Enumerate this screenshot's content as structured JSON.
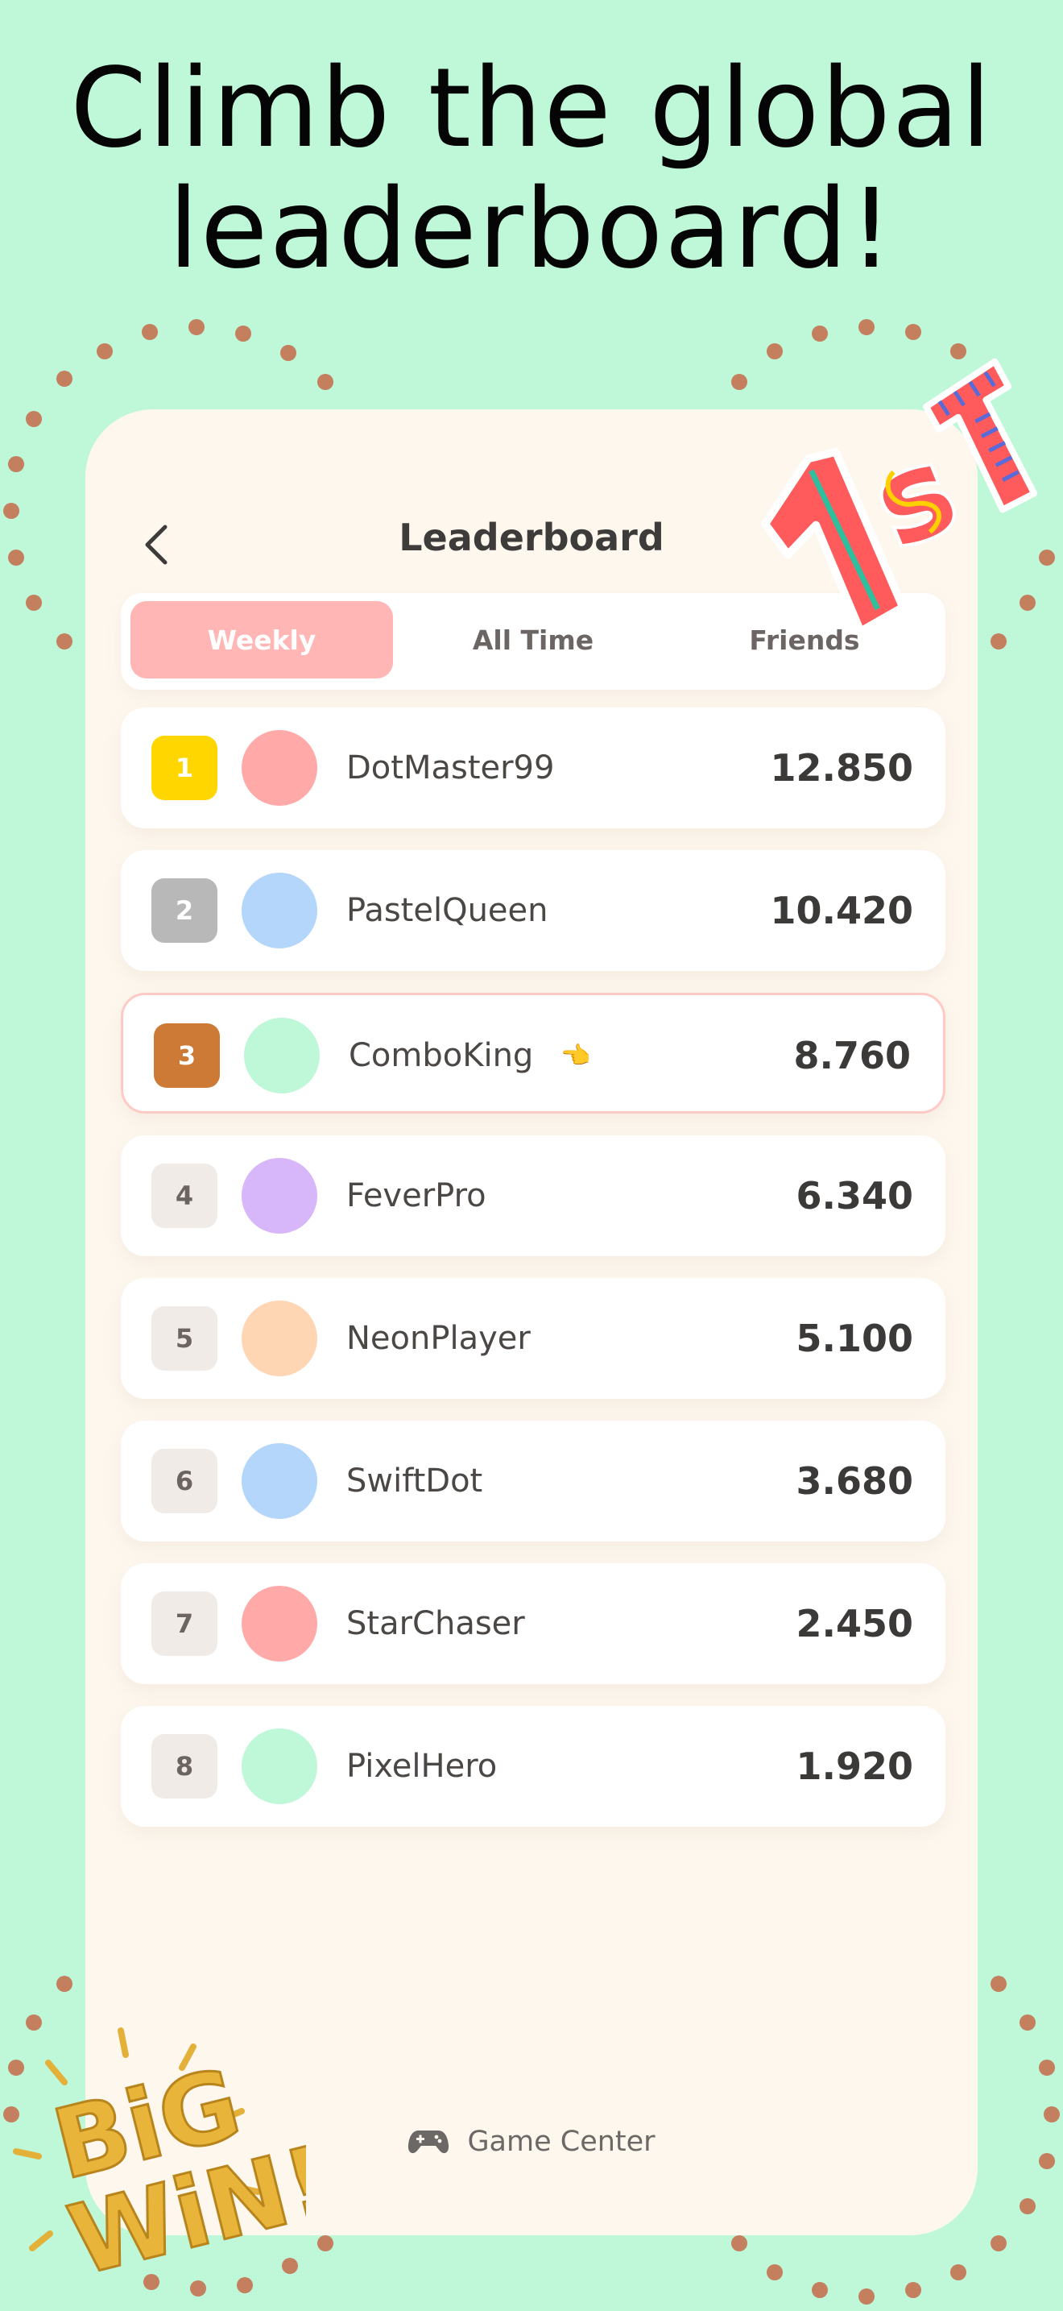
{
  "headline": {
    "line1": "Climb the global",
    "line2": "leaderboard!"
  },
  "screen": {
    "title": "Leaderboard"
  },
  "tabs": [
    {
      "label": "Weekly",
      "active": true
    },
    {
      "label": "All Time",
      "active": false
    },
    {
      "label": "Friends",
      "active": false
    }
  ],
  "rows": [
    {
      "rank": "1",
      "name": "DotMaster99",
      "score": "12.850",
      "rank_color": "#ffd600",
      "avatar_color": "#ffaaa9"
    },
    {
      "rank": "2",
      "name": "PastelQueen",
      "score": "10.420",
      "rank_color": "#b8b8b8",
      "avatar_color": "#b4d6fb"
    },
    {
      "rank": "3",
      "name": "ComboKing",
      "score": "8.760",
      "rank_color": "#cc7a36",
      "avatar_color": "#bff8d8",
      "highlight": true,
      "pointer": "👈"
    },
    {
      "rank": "4",
      "name": "FeverPro",
      "score": "6.340",
      "rank_color": "#f0ebe6",
      "avatar_color": "#d8b6fa"
    },
    {
      "rank": "5",
      "name": "NeonPlayer",
      "score": "5.100",
      "rank_color": "#f0ebe6",
      "avatar_color": "#ffd6b4"
    },
    {
      "rank": "6",
      "name": "SwiftDot",
      "score": "3.680",
      "rank_color": "#f0ebe6",
      "avatar_color": "#b4d6fb"
    },
    {
      "rank": "7",
      "name": "StarChaser",
      "score": "2.450",
      "rank_color": "#f0ebe6",
      "avatar_color": "#ffaaa9"
    },
    {
      "rank": "8",
      "name": "PixelHero",
      "score": "1.920",
      "rank_color": "#f0ebe6",
      "avatar_color": "#bff8d8"
    }
  ],
  "footer": {
    "label": "Game Center",
    "icon": "gamepad-icon"
  },
  "stickers": {
    "top": "1st",
    "bottom": "BIG WIN!"
  },
  "colors": {
    "background": "#bff8d8",
    "card": "#fdf7ee",
    "accent": "#ffb6b5",
    "dot": "#c47f5f"
  }
}
